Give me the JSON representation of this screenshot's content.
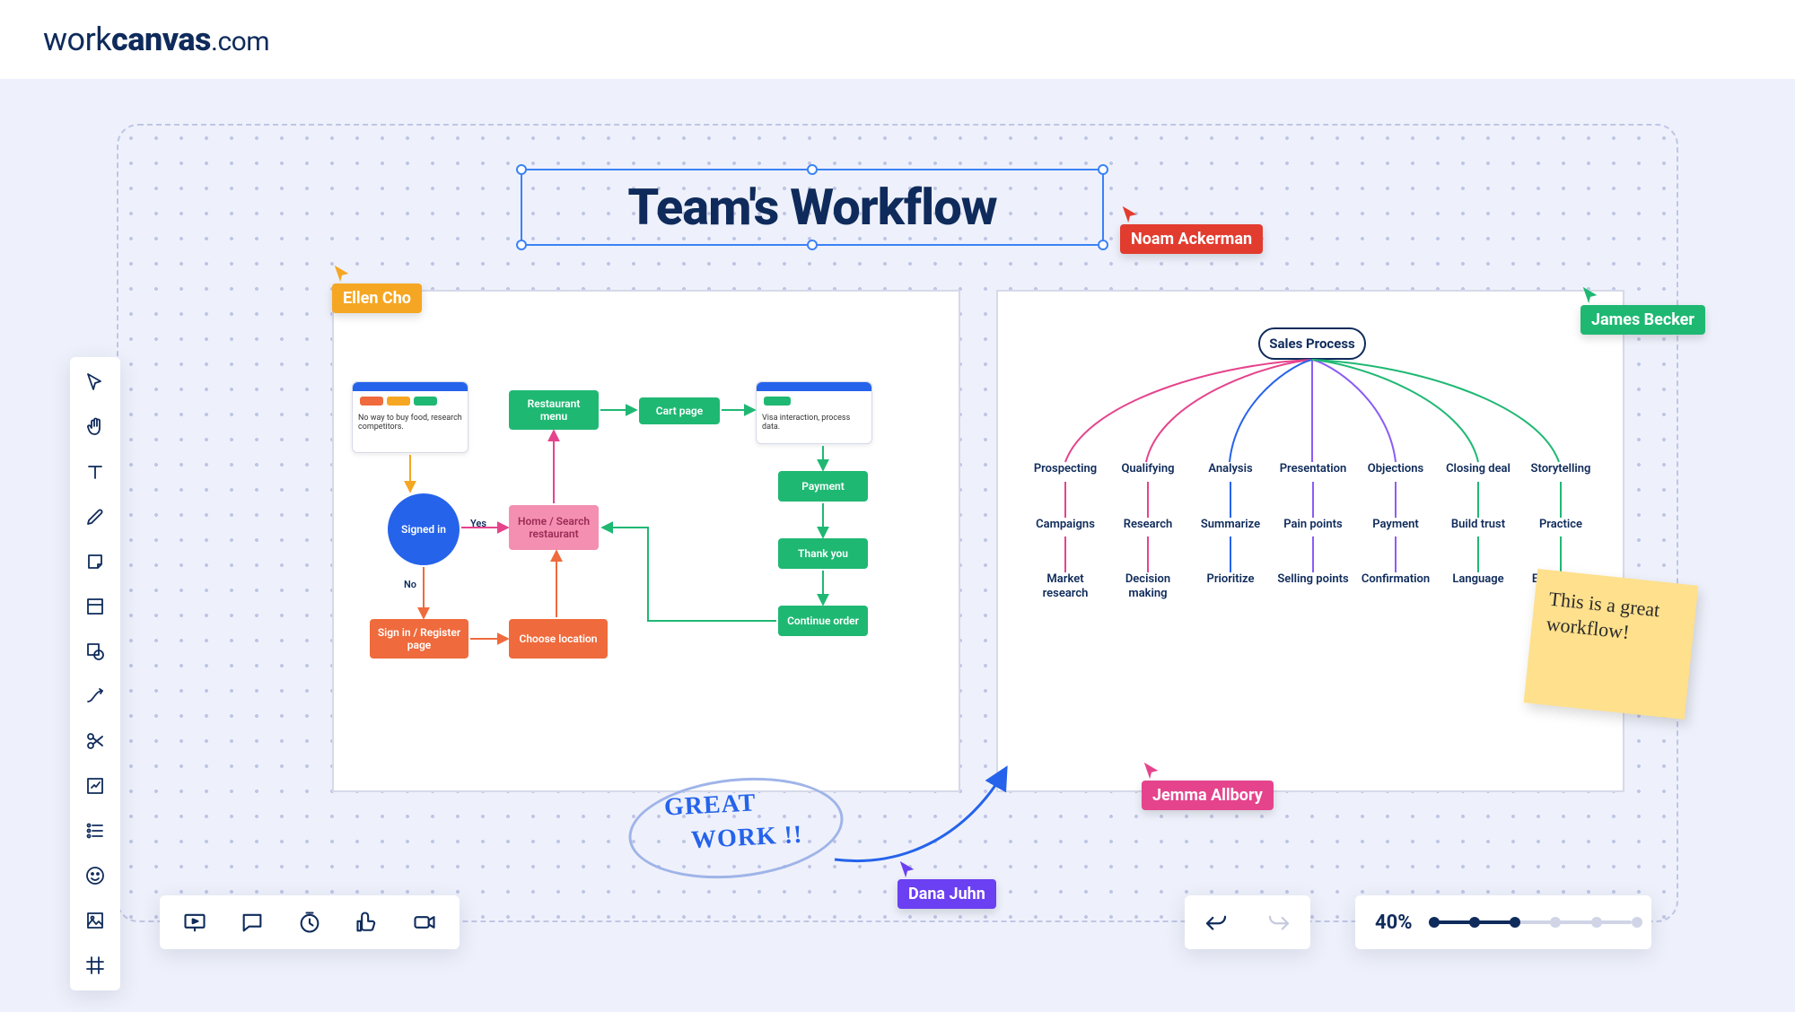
{
  "brand": {
    "pre": "work",
    "bold": "canvas",
    "dom": ".com"
  },
  "canvas_title": "Team's Workflow",
  "cursors": {
    "ellen": {
      "name": "Ellen Cho",
      "color": "#f5a623"
    },
    "noam": {
      "name": "Noam Ackerman",
      "color": "#e23c2f"
    },
    "james": {
      "name": "James Becker",
      "color": "#1fb873"
    },
    "jemma": {
      "name": "Jemma Allbory",
      "color": "#e5448d"
    },
    "dana": {
      "name": "Dana Juhn",
      "color": "#6b3ff2"
    }
  },
  "zoom_level": "40%",
  "sticky_note": "This is a great workflow!",
  "handwriting": {
    "line1": "GREAT",
    "line2": "WORK !!"
  },
  "flowchart": {
    "card_text": "No way to buy food, research competitors.",
    "card2_text": "Visa interaction, process data.",
    "signed_in": "Signed in",
    "yes": "Yes",
    "no": "No",
    "sign_in_register": "Sign in / Register page",
    "home_search": "Home / Search restaurant",
    "choose_location": "Choose location",
    "restaurant_menu": "Restaurant menu",
    "cart_page": "Cart page",
    "payment": "Payment",
    "thank_you": "Thank you",
    "continue_order": "Continue order"
  },
  "mindmap": {
    "root": "Sales Process",
    "branches": [
      {
        "color": "#e5448d",
        "l1": "Prospecting",
        "l2": "Campaigns",
        "l3": "Market research"
      },
      {
        "color": "#e5448d",
        "l1": "Qualifying",
        "l2": "Research",
        "l3": "Decision making"
      },
      {
        "color": "#2563eb",
        "l1": "Analysis",
        "l2": "Summarize",
        "l3": "Prioritize"
      },
      {
        "color": "#8b5cf6",
        "l1": "Presentation",
        "l2": "Pain points",
        "l3": "Selling points"
      },
      {
        "color": "#8b5cf6",
        "l1": "Objections",
        "l2": "Payment",
        "l3": "Confirmation"
      },
      {
        "color": "#1fb873",
        "l1": "Closing deal",
        "l2": "Build trust",
        "l3": "Language"
      },
      {
        "color": "#1fb873",
        "l1": "Storytelling",
        "l2": "Practice",
        "l3": "Experience"
      }
    ]
  },
  "toolbar_items": [
    "pointer-tool",
    "hand-tool",
    "text-tool",
    "pen-tool",
    "sticky-tool",
    "frame-tool",
    "shape-tool",
    "connector-tool",
    "scissors-tool",
    "chart-tool",
    "checklist-tool",
    "emoji-tool",
    "image-tool",
    "grid-tool"
  ],
  "bottom_items": [
    "present",
    "comment",
    "timer",
    "reactions",
    "record"
  ]
}
